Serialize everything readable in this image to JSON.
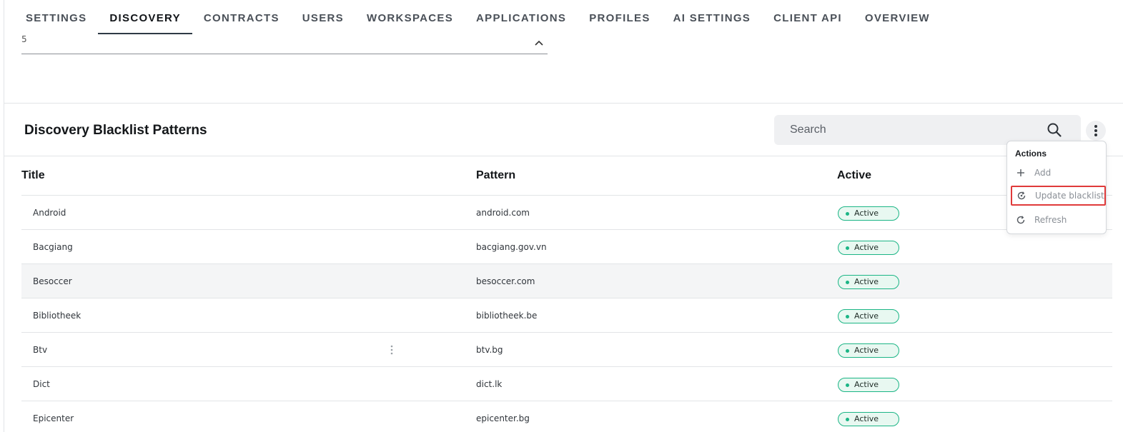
{
  "tabs": [
    {
      "label": "SETTINGS",
      "active": false
    },
    {
      "label": "DISCOVERY",
      "active": true
    },
    {
      "label": "CONTRACTS",
      "active": false
    },
    {
      "label": "USERS",
      "active": false
    },
    {
      "label": "WORKSPACES",
      "active": false
    },
    {
      "label": "APPLICATIONS",
      "active": false
    },
    {
      "label": "PROFILES",
      "active": false
    },
    {
      "label": "AI SETTINGS",
      "active": false
    },
    {
      "label": "CLIENT API",
      "active": false
    },
    {
      "label": "OVERVIEW",
      "active": false
    }
  ],
  "top_select": {
    "value": "5",
    "icon": "chevron-up-icon"
  },
  "section": {
    "title": "Discovery Blacklist Patterns"
  },
  "search": {
    "placeholder": "Search",
    "icon": "search-icon"
  },
  "table": {
    "columns": [
      "Title",
      "Pattern",
      "Active"
    ],
    "rows": [
      {
        "title": "Android",
        "pattern": "android.com",
        "status": "Active"
      },
      {
        "title": "Bacgiang",
        "pattern": "bacgiang.gov.vn",
        "status": "Active"
      },
      {
        "title": "Besoccer",
        "pattern": "besoccer.com",
        "status": "Active"
      },
      {
        "title": "Bibliotheek",
        "pattern": "bibliotheek.be",
        "status": "Active"
      },
      {
        "title": "Btv",
        "pattern": "btv.bg",
        "status": "Active"
      },
      {
        "title": "Dict",
        "pattern": "dict.lk",
        "status": "Active"
      },
      {
        "title": "Epicenter",
        "pattern": "epicenter.bg",
        "status": "Active"
      }
    ]
  },
  "actions_menu": {
    "header": "Actions",
    "items": [
      {
        "label": "Add",
        "icon": "plus-icon"
      },
      {
        "label": "Update blacklist",
        "icon": "sync-icon"
      },
      {
        "label": "Refresh",
        "icon": "refresh-icon"
      }
    ]
  },
  "colors": {
    "accent_green": "#1bb585",
    "highlight_outline": "#e03a3a"
  }
}
